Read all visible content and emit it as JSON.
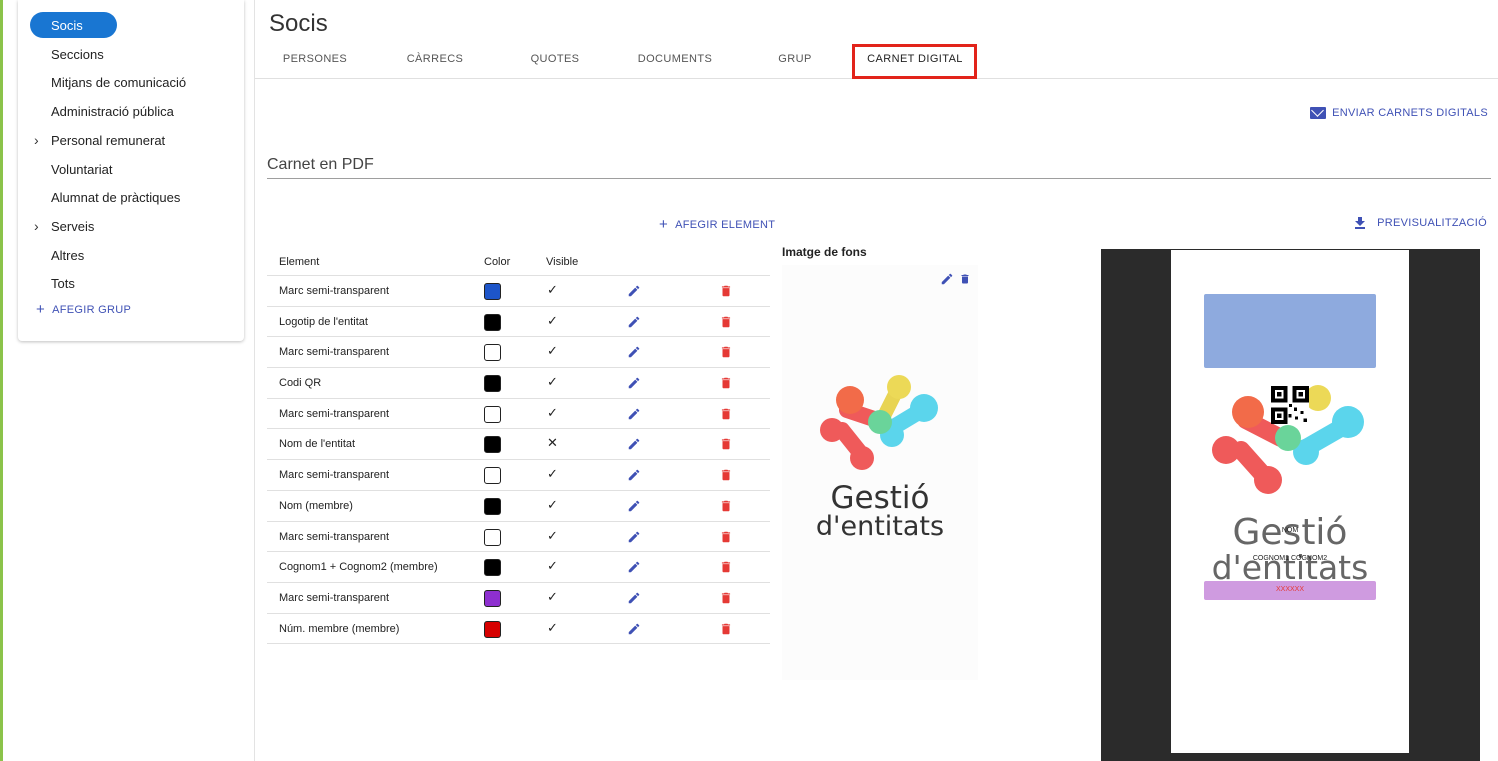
{
  "sidebar": {
    "items": [
      {
        "label": "Socis"
      },
      {
        "label": "Seccions"
      },
      {
        "label": "Mitjans de comunicació"
      },
      {
        "label": "Administració pública"
      },
      {
        "label": "Personal remunerat"
      },
      {
        "label": "Voluntariat"
      },
      {
        "label": "Alumnat de pràctiques"
      },
      {
        "label": "Serveis"
      },
      {
        "label": "Altres"
      },
      {
        "label": "Tots"
      }
    ],
    "add_group": "AFEGIR GRUP"
  },
  "header": {
    "title": "Socis",
    "tabs": [
      {
        "label": "PERSONES"
      },
      {
        "label": "CÀRRECS"
      },
      {
        "label": "QUOTES"
      },
      {
        "label": "DOCUMENTS"
      },
      {
        "label": "GRUP"
      },
      {
        "label": "CARNET DIGITAL"
      }
    ],
    "active_tab": "CARNET DIGITAL",
    "highlight_color": "#e2231a"
  },
  "actions": {
    "send": "ENVIAR CARNETS DIGITALS",
    "add_element": "AFEGIR ELEMENT",
    "preview": "PREVISUALITZACIÓ"
  },
  "section": {
    "title": "Carnet en PDF"
  },
  "table": {
    "headers": {
      "element": "Element",
      "color": "Color",
      "visible": "Visible"
    },
    "rows": [
      {
        "element": "Marc semi-transparent",
        "color": "#1d55c9",
        "visible": "✓"
      },
      {
        "element": "Logotip de l'entitat",
        "color": "#000000",
        "visible": "✓"
      },
      {
        "element": "Marc semi-transparent",
        "color": "#ffffff",
        "visible": "✓"
      },
      {
        "element": "Codi QR",
        "color": "#000000",
        "visible": "✓"
      },
      {
        "element": "Marc semi-transparent",
        "color": "#ffffff",
        "visible": "✓"
      },
      {
        "element": "Nom de l'entitat",
        "color": "#000000",
        "visible": "✕"
      },
      {
        "element": "Marc semi-transparent",
        "color": "#ffffff",
        "visible": "✓"
      },
      {
        "element": "Nom (membre)",
        "color": "#000000",
        "visible": "✓"
      },
      {
        "element": "Marc semi-transparent",
        "color": "#ffffff",
        "visible": "✓"
      },
      {
        "element": "Cognom1 + Cognom2 (membre)",
        "color": "#000000",
        "visible": "✓"
      },
      {
        "element": "Marc semi-transparent",
        "color": "#8e2fd0",
        "visible": "✓"
      },
      {
        "element": "Núm. membre (membre)",
        "color": "#d60000",
        "visible": "✓"
      }
    ]
  },
  "background": {
    "label": "Imatge de fons",
    "logo_line1": "Gestió",
    "logo_line2": "d'entitats"
  },
  "preview": {
    "name": "NOM",
    "surnames": "COGNOM1 COGNOM2",
    "number": "XXXXXX",
    "logo_line1": "Gestió",
    "logo_line2": "d'entitats"
  }
}
